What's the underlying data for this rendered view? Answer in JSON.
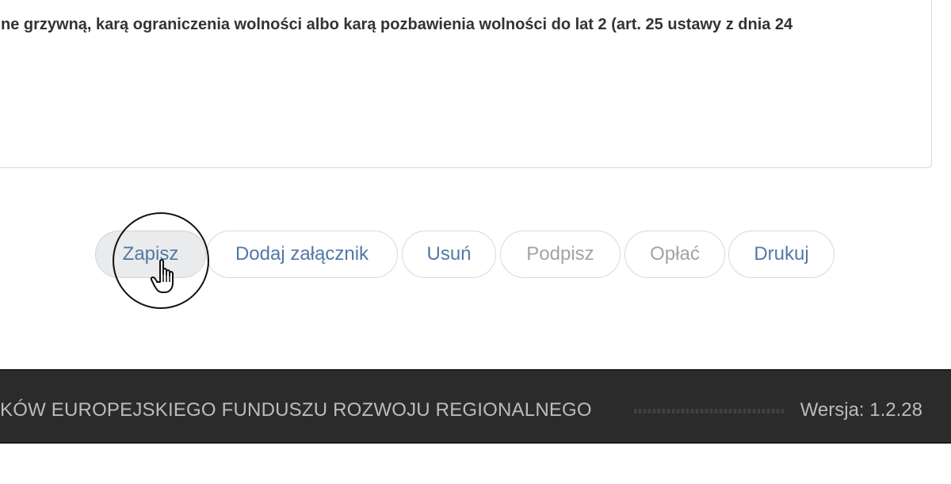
{
  "content": {
    "text": "ne grzywną, karą ograniczenia wolności albo karą pozbawienia wolności do lat 2 (art. 25 ustawy z dnia 24"
  },
  "actions": {
    "save": "Zapisz",
    "add_attachment": "Dodaj załącznik",
    "delete": "Usuń",
    "sign": "Podpisz",
    "pay": "Opłać",
    "print": "Drukuj"
  },
  "footer": {
    "program": "KÓW EUROPEJSKIEGO FUNDUSZU ROZWOJU REGIONALNEGO",
    "version": "Wersja: 1.2.28"
  },
  "colors": {
    "link": "#5478a6",
    "disabled": "#a3a3a3",
    "footer_bg": "#2b2b2b"
  },
  "icons": {
    "cursor": "hand-pointer-icon"
  }
}
